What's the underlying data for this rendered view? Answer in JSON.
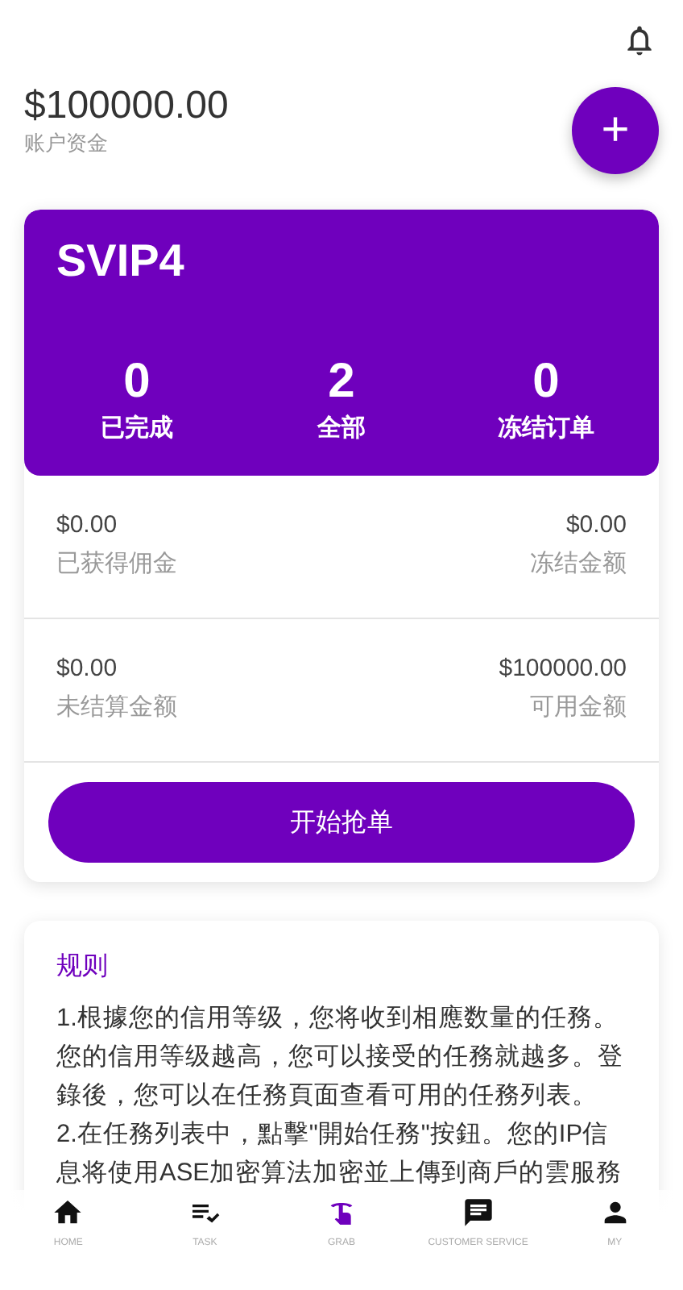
{
  "balance": {
    "amount": "$100000.00",
    "label": "账户资金"
  },
  "fab": {
    "label": "+"
  },
  "level_card": {
    "title": "SVIP4",
    "stats": [
      {
        "value": "0",
        "label": "已完成"
      },
      {
        "value": "2",
        "label": "全部"
      },
      {
        "value": "0",
        "label": "冻结订单"
      }
    ]
  },
  "money_rows": [
    {
      "left": {
        "amount": "$0.00",
        "label": "已获得佣金"
      },
      "right": {
        "amount": "$0.00",
        "label": "冻结金额"
      }
    },
    {
      "left": {
        "amount": "$0.00",
        "label": "未结算金额"
      },
      "right": {
        "amount": "$100000.00",
        "label": "可用金额"
      }
    }
  ],
  "start_button": "开始抢单",
  "rules": {
    "title": "规则",
    "paragraphs": [
      "1.根據您的信用等级，您将收到相應数量的任務。您的信用等级越高，您可以接受的任務就越多。登錄後，您可以在任務頁面查看可用的任務列表。",
      "2.在任務列表中，點擊\"開始任務\"按鈕。您的IP信息将使用ASE加密算法加密並上傳到商戶的雲服務"
    ]
  },
  "nav": [
    {
      "kind": "home",
      "label": "HOME",
      "selected": false
    },
    {
      "kind": "task",
      "label": "TASK",
      "selected": false
    },
    {
      "kind": "grab",
      "label": "GRAB",
      "selected": true
    },
    {
      "kind": "service",
      "label": "CUSTOMER SERVICE",
      "selected": false
    },
    {
      "kind": "my",
      "label": "MY",
      "selected": false
    }
  ]
}
